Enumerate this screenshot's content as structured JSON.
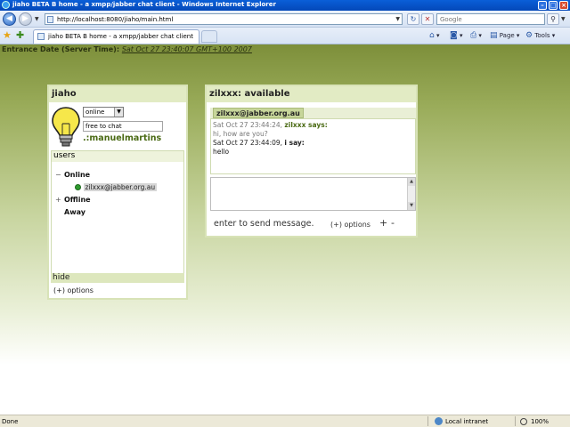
{
  "browser": {
    "window_title": "jiaho BETA B home - a xmpp/jabber chat client - Windows Internet Explorer",
    "address_url": "http://localhost:8080/jiaho/main.html",
    "search_placeholder": "Google",
    "tab_title": "jiaho BETA B home - a xmpp/jabber chat client",
    "commands": {
      "page": "Page",
      "tools": "Tools"
    },
    "status_text": "Done",
    "zone": "Local intranet",
    "zoom": "100%"
  },
  "page": {
    "entrance_label": "Entrance Date (Server Time):",
    "entrance_date": "Sat Oct 27 23:40:07 GMT+100 2007"
  },
  "left_panel": {
    "title": "jiaho",
    "status_value": "online",
    "status_message": "free to chat",
    "username": ".:manuelmartins",
    "users_label": "users",
    "groups": [
      {
        "toggle": "−",
        "name": "Online"
      },
      {
        "toggle": "+",
        "name": "Offline"
      },
      {
        "toggle": "",
        "name": "Away"
      }
    ],
    "contact_jid": "zilxxx@jabber.org.au",
    "hide_label": "hide",
    "options_label": "(+) options"
  },
  "chat_panel": {
    "title": "zilxxx: available",
    "tab_label": "zilxxx@jabber.org.au",
    "messages": [
      {
        "time": "Sat Oct 27 23:44:24,",
        "who": "zilxxx says:",
        "text": "hi, how are you?"
      },
      {
        "time": "Sat Oct 27 23:44:09,",
        "who": "i say:",
        "text": "hello"
      }
    ],
    "hint": "enter to send message.",
    "options_label": "(+) options",
    "plus": "+",
    "minus": "-"
  },
  "colors": {
    "accent_green": "#4a6a14",
    "panel_header": "#e2ebc4",
    "online_dot": "#2f9a2f"
  }
}
